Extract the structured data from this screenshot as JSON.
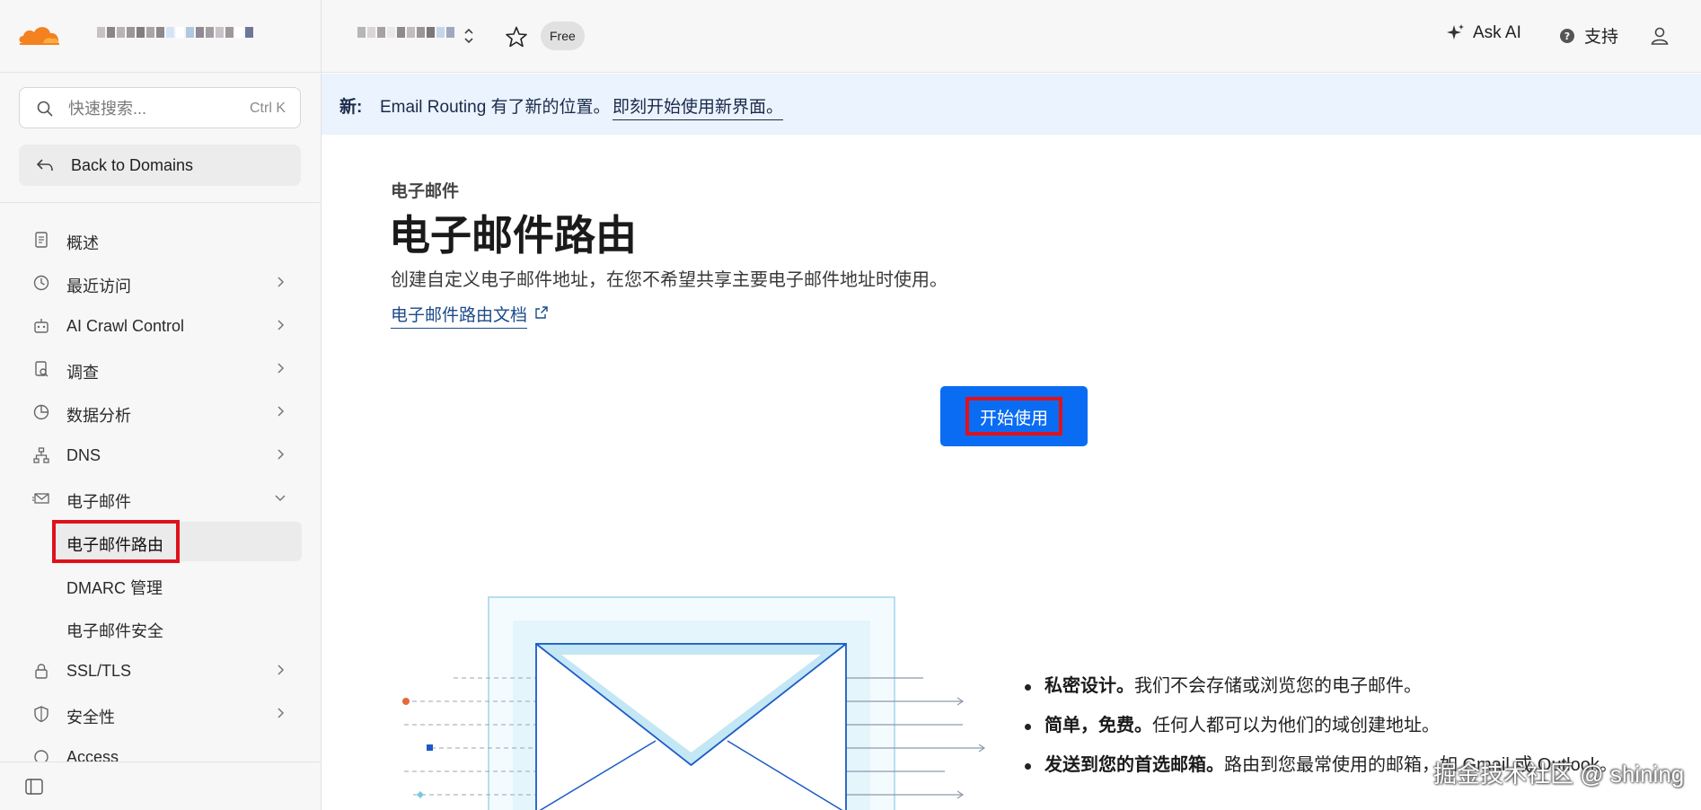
{
  "colors": {
    "accent": "#0a6cf2",
    "cloudflare_orange": "#f48120",
    "highlight_red": "#e0111a",
    "banner_bg": "#eaf3fe"
  },
  "sidebar": {
    "search": {
      "placeholder": "快速搜索...",
      "shortcut": "Ctrl K",
      "icon": "search-icon"
    },
    "back_label": "Back to Domains",
    "items": [
      {
        "label": "概述",
        "icon": "document-icon"
      },
      {
        "label": "最近访问",
        "icon": "clock-icon"
      },
      {
        "label": "AI Crawl Control",
        "icon": "robot-icon"
      },
      {
        "label": "调查",
        "icon": "investigate-icon"
      },
      {
        "label": "数据分析",
        "icon": "pie-chart-icon"
      },
      {
        "label": "DNS",
        "icon": "network-icon"
      },
      {
        "label": "电子邮件",
        "icon": "mail-icon"
      }
    ],
    "email_sub": [
      {
        "label": "电子邮件路由"
      },
      {
        "label": "DMARC 管理"
      },
      {
        "label": "电子邮件安全"
      }
    ],
    "items_after": [
      {
        "label": "SSL/TLS",
        "icon": "lock-icon"
      },
      {
        "label": "安全性",
        "icon": "shield-icon"
      },
      {
        "label": "Access",
        "icon": "access-icon"
      }
    ]
  },
  "topbar": {
    "badge": "Free",
    "ask_ai": "Ask AI",
    "support": "支持"
  },
  "banner": {
    "new_label": "新:",
    "message": "Email Routing 有了新的位置。",
    "link": "即刻开始使用新界面。"
  },
  "main": {
    "breadcrumb": "电子邮件",
    "title": "电子邮件路由",
    "description": "创建自定义电子邮件地址，在您不希望共享主要电子邮件地址时使用。",
    "doc_link": "电子邮件路由文档",
    "start_button": "开始使用",
    "features": [
      {
        "bold": "私密设计。",
        "text": "我们不会存储或浏览您的电子邮件。"
      },
      {
        "bold": "简单，免费。",
        "text": "任何人都可以为他们的域创建地址。"
      },
      {
        "bold": "发送到您的首选邮箱。",
        "text": "路由到您最常使用的邮箱，如 Gmail 或 Outlook。"
      }
    ]
  },
  "watermark": "掘金技术社区 @ shining"
}
